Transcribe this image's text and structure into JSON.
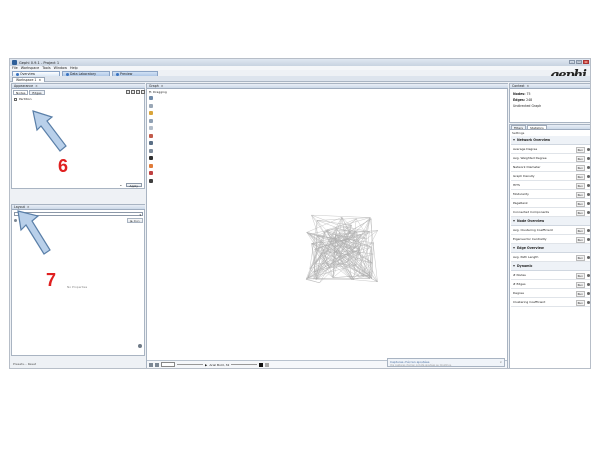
{
  "window": {
    "title": "Gephi 0.9.1 - Project 1"
  },
  "menu": [
    "File",
    "Workspace",
    "Tools",
    "Window",
    "Help"
  ],
  "main_tabs": [
    {
      "label": "Overview",
      "active": true
    },
    {
      "label": "Data Laboratory",
      "active": false
    },
    {
      "label": "Preview",
      "active": false
    }
  ],
  "logo_text": "gephi",
  "workspace_tab": {
    "label": "Workspace 1"
  },
  "appearance": {
    "title": "Appearance",
    "tabs": [
      "Nodes",
      "Edges"
    ],
    "checkbox_label": "Partition",
    "apply_label": "Apply"
  },
  "layout": {
    "title": "Layout",
    "select_value": "",
    "run_label": "Run",
    "no_properties": "No Properties"
  },
  "graph": {
    "title": "Graph",
    "mode_label": "Dragging",
    "bottom_text": "Arial Bold, 32",
    "notice_title": "Captures d'écran ajoutées",
    "notice_body": "Vos captures d'écran ont été ajoutées au OneDrive."
  },
  "context": {
    "title": "Context",
    "nodes_label": "Nodes:",
    "nodes_value": "75",
    "edges_label": "Edges:",
    "edges_value": "248",
    "graph_type": "Undirected Graph"
  },
  "stats": {
    "tabs": [
      "Filters",
      "Statistics"
    ],
    "settings_label": "Settings",
    "run_label": "Run",
    "sections": [
      {
        "title": "Network Overview",
        "items": [
          "Average Degree",
          "Avg. Weighted Degree",
          "Network Diameter",
          "Graph Density",
          "HITS",
          "Modularity",
          "PageRank",
          "Connected Components"
        ]
      },
      {
        "title": "Node Overview",
        "items": [
          "Avg. Clustering Coefficient",
          "Eigenvector Centrality"
        ]
      },
      {
        "title": "Edge Overview",
        "items": [
          "Avg. Path Length"
        ]
      },
      {
        "title": "Dynamic",
        "items": [
          "# Nodes",
          "# Edges",
          "Degree",
          "Clustering Coefficient"
        ]
      }
    ]
  },
  "status_bar": {
    "text": "Presets... Reset"
  },
  "annotations": [
    {
      "label": "6"
    },
    {
      "label": "7"
    }
  ],
  "colors": {
    "annotation_red": "#e02020",
    "arrow_fill": "#b9d0ea",
    "arrow_stroke": "#5a7fa8"
  }
}
